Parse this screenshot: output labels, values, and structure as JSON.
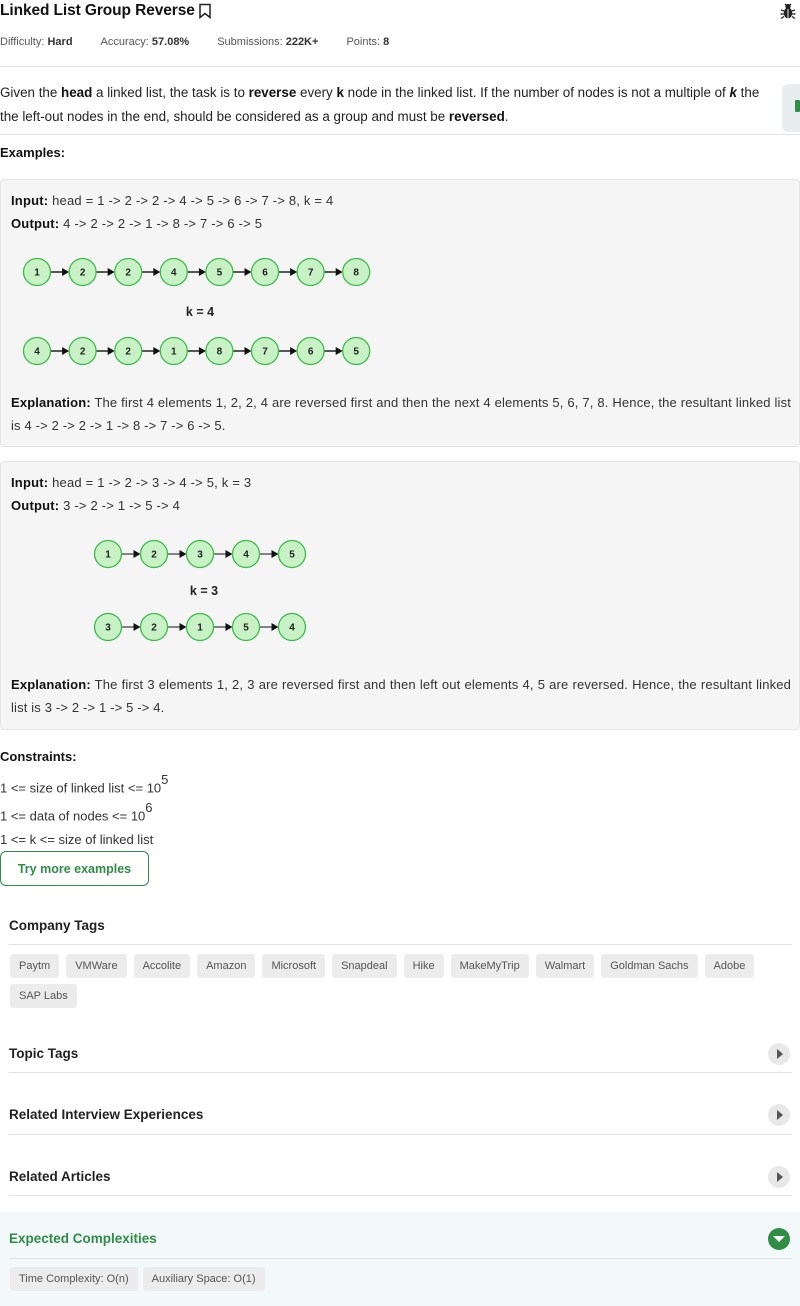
{
  "problem": {
    "title": "Linked List Group Reverse",
    "meta": {
      "difficulty_label": "Difficulty:",
      "difficulty": "Hard",
      "accuracy_label": "Accuracy:",
      "accuracy": "57.08%",
      "submissions_label": "Submissions:",
      "submissions": "222K+",
      "points_label": "Points:",
      "points": "8"
    },
    "description": {
      "p1": "Given the ",
      "b1": "head",
      "p2": " a linked list, the task is to ",
      "b2": "reverse",
      "p3": " every ",
      "b3": "k",
      "p4": " node in the linked list. If the number of nodes is not a multiple of ",
      "b4": "k",
      "p5": " the",
      "p6": "the left-out nodes in the end, should be considered as a group and must be ",
      "b5": "reversed",
      "p7": "."
    },
    "examples_label": "Examples:",
    "example1": {
      "input_label": "Input:",
      "input": "head = 1 -> 2 -> 2 -> 4 -> 5 -> 6 -> 7 -> 8, k = 4",
      "output_label": "Output:",
      "output": "4 -> 2 -> 2 -> 1 -> 8 -> 7 -> 6 -> 5",
      "k_label": "k = 4",
      "before": [
        "1",
        "2",
        "2",
        "4",
        "5",
        "6",
        "7",
        "8"
      ],
      "after": [
        "4",
        "2",
        "2",
        "1",
        "8",
        "7",
        "6",
        "5"
      ],
      "explanation_label": "Explanation:",
      "explanation": "The first 4 elements 1, 2, 2, 4 are reversed first and then the next 4 elements 5, 6, 7, 8. Hence, the resultant linked list is 4 -> 2 -> 2 -> 1 -> 8 -> 7 -> 6 -> 5."
    },
    "example2": {
      "input_label": "Input:",
      "input": "head = 1 -> 2 -> 3 -> 4 -> 5, k = 3",
      "output_label": "Output:",
      "output": "3 -> 2 -> 1 -> 5 -> 4",
      "k_label": "k = 3",
      "before": [
        "1",
        "2",
        "3",
        "4",
        "5"
      ],
      "after": [
        "3",
        "2",
        "1",
        "5",
        "4"
      ],
      "explanation_label": "Explanation:",
      "explanation": "The first 3 elements 1, 2, 3 are reversed first and then left out elements 4, 5 are reversed. Hence, the resultant linked list is 3 -> 2 -> 1 -> 5 -> 4."
    },
    "constraints": {
      "label": "Constraints:",
      "c1": "1 <= size of linked list <= 10",
      "c1_sup": "5",
      "c2": "1 <= data of nodes <= 10",
      "c2_sup": "6",
      "c3": "1 <= k <= size of linked list"
    },
    "try_more": "Try more examples"
  },
  "company_tags": {
    "label": "Company Tags",
    "items": [
      "Paytm",
      "VMWare",
      "Accolite",
      "Amazon",
      "Microsoft",
      "Snapdeal",
      "Hike",
      "MakeMyTrip",
      "Walmart",
      "Goldman Sachs",
      "Adobe",
      "SAP Labs"
    ]
  },
  "sections": {
    "topic_tags": "Topic Tags",
    "interview": "Related Interview Experiences",
    "articles": "Related Articles",
    "complexities": "Expected Complexities"
  },
  "complexities": {
    "time": "Time Complexity: O(n)",
    "space": "Auxiliary Space: O(1)"
  },
  "colors": {
    "accent": "#2f8d46",
    "node_fill": "#c8f2c5",
    "node_stroke": "#3dbb4a"
  },
  "icons": {
    "bookmark": "bookmark-icon",
    "bug": "bug-icon",
    "expand": "chevron-right-icon",
    "collapse": "chevron-down-icon"
  }
}
